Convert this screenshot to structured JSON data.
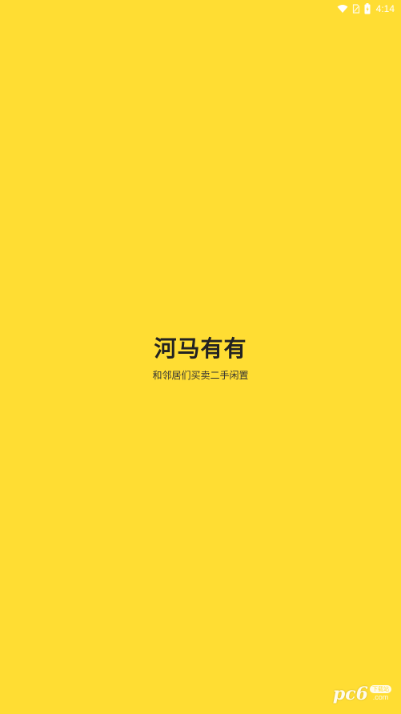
{
  "status_bar": {
    "time": "4:14",
    "icons": [
      "wifi-icon",
      "no-sim-icon",
      "battery-icon"
    ]
  },
  "splash": {
    "title": "河马有有",
    "subtitle": "和邻居们买卖二手闲置"
  },
  "watermark": {
    "logo_text": "pc6",
    "badge": "下载站",
    "domain": ".com"
  },
  "colors": {
    "background": "#FFDD33",
    "title": "#222222",
    "subtitle": "#333333",
    "status_icons": "#FFFFFF"
  }
}
